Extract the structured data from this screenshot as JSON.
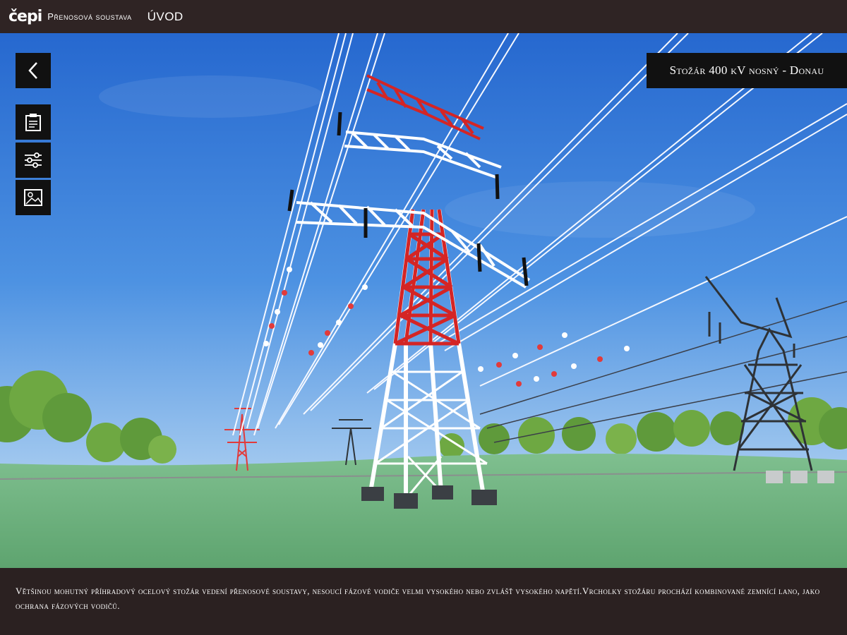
{
  "header": {
    "logo_text": "čepi",
    "app_title": "Přenosová soustava",
    "nav_home": "ÚVOD"
  },
  "toolbar": {
    "back_icon": "chevron-left-icon",
    "info_icon": "clipboard-icon",
    "settings_icon": "sliders-icon",
    "gallery_icon": "image-icon"
  },
  "scene": {
    "title": "Stožár 400 kV nosný - Donau"
  },
  "caption": {
    "text": "Většinou mohutný příhradový ocelový stožár vedení přenosové soustavy, nesoucí fázové vodiče velmi vysokého nebo zvlášť vysokého napětí.Vrcholky stožáru prochází kombinované zemnící lano, jako ochrana fázových vodičů."
  },
  "colors": {
    "bar_background": "#2f2424",
    "button_background": "#111111",
    "tower_red": "#d42525",
    "tower_dark": "#3a3f44",
    "sky_top": "#2a73d6",
    "grass": "#6db083"
  }
}
